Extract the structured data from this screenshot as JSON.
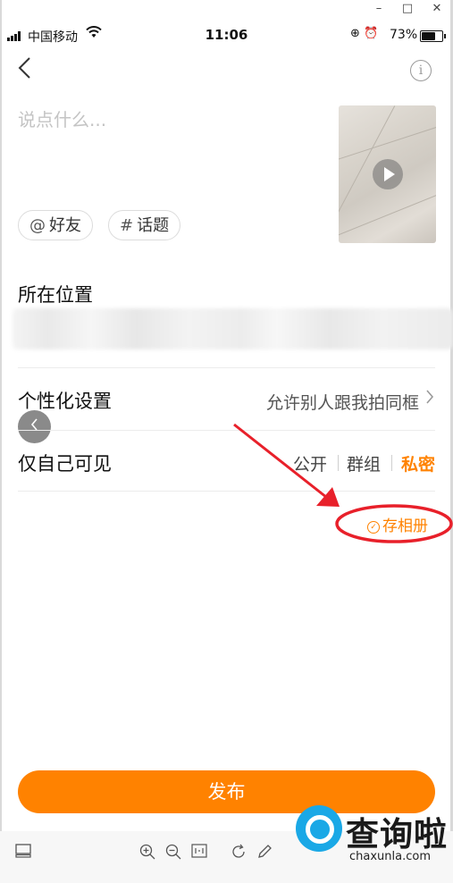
{
  "window": {
    "minimize": "–",
    "maximize": "□",
    "close": "✕"
  },
  "status_bar": {
    "carrier": "中国移动",
    "time": "11:06",
    "battery_percent": "73%",
    "battery_level": 0.73
  },
  "post": {
    "placeholder": "说点什么...",
    "mention_chip": {
      "symbol": "@",
      "label": "好友"
    },
    "topic_chip": {
      "symbol": "#",
      "label": "话题"
    }
  },
  "location": {
    "title": "所在位置"
  },
  "personalize": {
    "title": "个性化设置",
    "value": "允许别人跟我拍同框"
  },
  "visibility": {
    "title": "仅自己可见",
    "options": [
      "公开",
      "群组",
      "私密"
    ],
    "selected": "私密"
  },
  "save_album": {
    "label": "存相册",
    "checked": true
  },
  "publish_button": {
    "label": "发布"
  },
  "watermark": {
    "name": "查询啦",
    "url": "chaxunla.com"
  },
  "colors": {
    "accent": "#ff8200",
    "annotation": "#e8202a"
  },
  "icons": [
    "back-icon",
    "info-icon",
    "play-icon",
    "chevron-right-icon",
    "zoom-in-icon",
    "zoom-out-icon",
    "actual-size-icon",
    "rotate-icon",
    "edit-icon",
    "screen-icon"
  ]
}
